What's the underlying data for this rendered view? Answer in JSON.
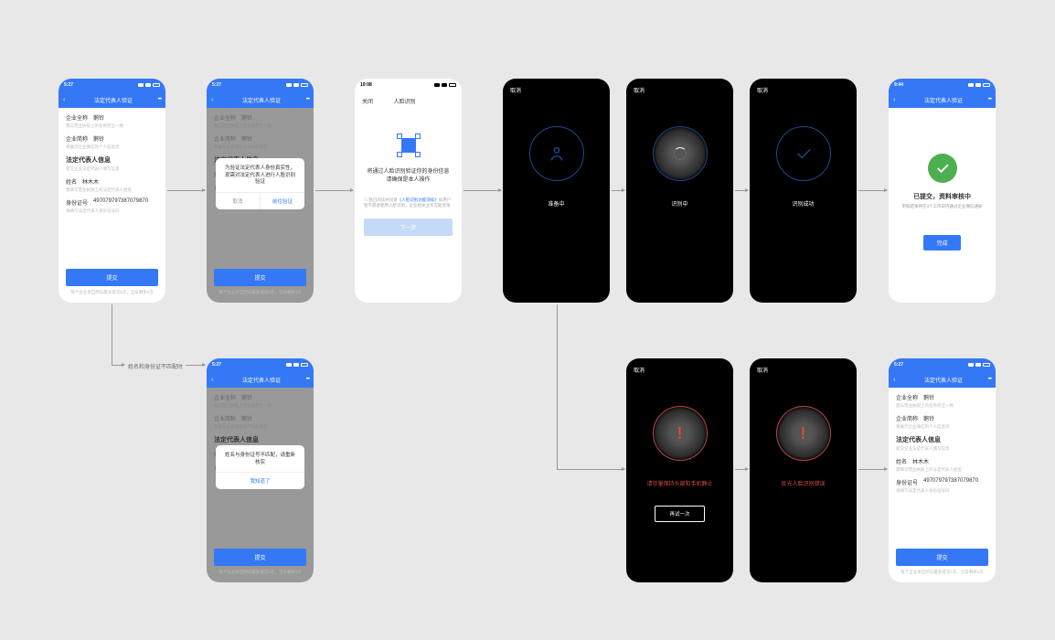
{
  "flow_label_mismatch": "姓名和身份证不匹配时",
  "header": {
    "title": "法定代表人验证",
    "time": "5:27",
    "time2": "10:08",
    "time3": "9:44"
  },
  "form": {
    "company_full_label": "企业全称",
    "company_full_value": "鹅铃",
    "company_full_hint": "需与营业执照上的名称完全一致",
    "company_short_label": "企业简称",
    "company_short_value": "鹅铃",
    "company_short_hint": "将展示企业微信的个人信息页",
    "section": "法定代表人信息",
    "section_hint": "提交企业法定代表人填写信息",
    "name_label": "姓名",
    "name_value": "林木木",
    "name_hint": "需填写营业执照上的法定代表人姓名",
    "id_label": "身份证号",
    "id_value": "497079797387079870",
    "id_hint": "请填写法定代表人身份证号码",
    "submit": "提交",
    "footer": "每个企业单自然日最多提交5次，当日剩余4次"
  },
  "modal_verify": {
    "text": "为验证法定代表人身份真实性，现需对法定代表人进行人脸识别验证",
    "cancel": "取消",
    "confirm": "前往验证"
  },
  "modal_mismatch": {
    "text": "姓名与身份证号不匹配，请重新核实",
    "ok": "我知道了"
  },
  "face_intro": {
    "close": "关闭",
    "title": "人脸识别",
    "msg": "将通过人脸识别验证你的身份信息 请确保是本人操作",
    "agree_pre": "我已阅读并同意",
    "agree_link": "《人脸识别功能须知》",
    "agree_post": "如用户暂不愿意使用人脸识别，企业相关业务可能受限",
    "next": "下一步"
  },
  "dark": {
    "cancel": "取消",
    "preparing": "准备中",
    "recognizing": "识别中",
    "success": "识别成功",
    "hold_still": "请尽量保持头部和手机静止",
    "glare_error": "反光人脸识别错误",
    "retry": "再试一次"
  },
  "success": {
    "title": "已提交，资料审核中",
    "sub": "审核结果将在3个工作日内通过企业微信通知",
    "done": "完成"
  }
}
